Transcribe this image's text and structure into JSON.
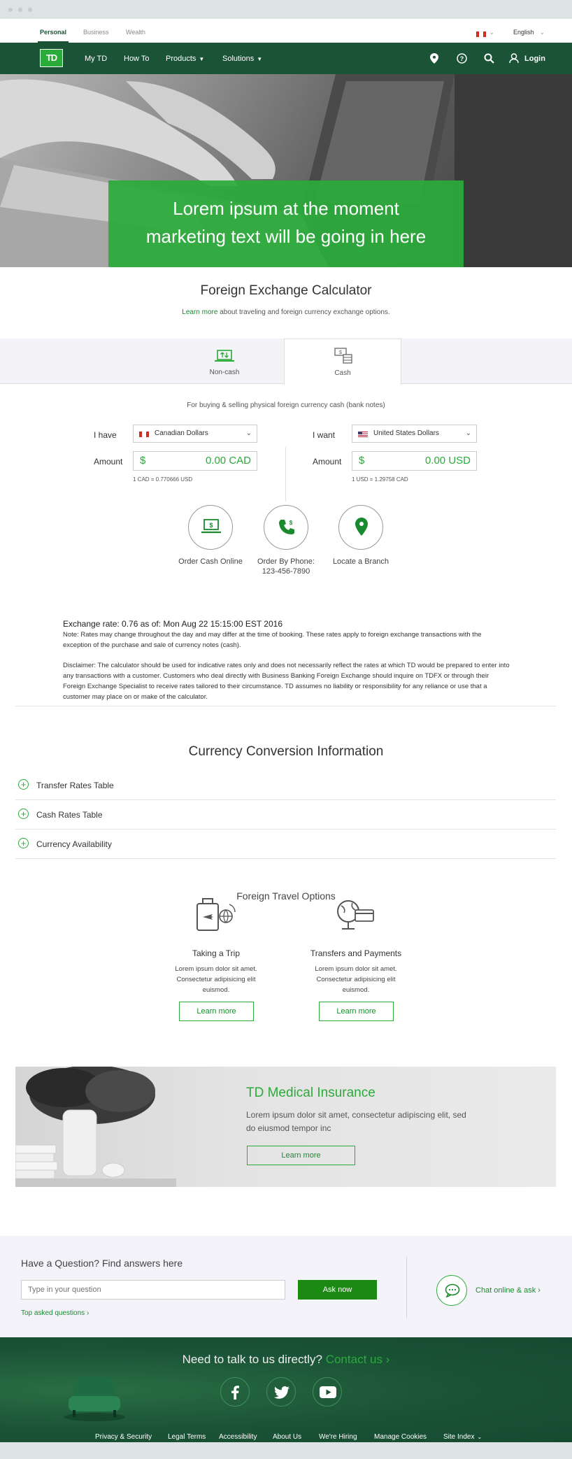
{
  "util": {
    "tabs": [
      "Personal",
      "Business",
      "Wealth"
    ],
    "language": "English"
  },
  "nav": {
    "logo": "TD",
    "items": [
      "My TD",
      "How To",
      "Products",
      "Solutions"
    ],
    "login": "Login"
  },
  "hero": {
    "line1": "Lorem ipsum at the moment",
    "line2": "marketing text will be going in here"
  },
  "calc": {
    "title": "Foreign Exchange Calculator",
    "learn_more": "Learn more",
    "subtitle_rest": " about traveling and foreign currency exchange options.",
    "tabs": [
      "Non-cash",
      "Cash"
    ],
    "desc": "For buying & selling physical foreign currency cash (bank notes)",
    "have_label": "I have",
    "want_label": "I want",
    "amount_label": "Amount",
    "have_currency": "Canadian Dollars",
    "want_currency": "United States Dollars",
    "currency_symbol": "$",
    "have_amount": "0.00 CAD",
    "want_amount": "0.00 USD",
    "have_rate": "1 CAD = 0.770666 USD",
    "want_rate": "1 USD = 1.29758 CAD"
  },
  "actions": {
    "order_online": "Order Cash Online",
    "order_phone": "Order By Phone:",
    "phone": "123-456-7890",
    "locate": "Locate a Branch"
  },
  "exchange": {
    "title": "Exchange rate: 0.76 as of: Mon Aug 22 15:15:00 EST 2016",
    "note": "Note: Rates may change throughout the day and may differ at the time of booking. These rates apply to foreign exchange transactions with the exception of the purchase and sale of currency notes (cash).",
    "disclaimer": "Disclaimer: The calculator should be used for indicative rates only and does not necessarily reflect the rates at which TD would be prepared to enter into any transactions with a customer. Customers who deal directly with Business Banking Foreign Exchange should inquire on TDFX or through their Foreign Exchange Specialist to receive rates tailored to their circumstance. TD assumes no liability or responsibility for any reliance or use that a customer may place on or make of the calculator."
  },
  "conversion": {
    "title": "Currency Conversion Information",
    "items": [
      "Transfer Rates Table",
      "Cash Rates Table",
      "Currency Availability"
    ]
  },
  "travel": {
    "title": "Foreign Travel Options",
    "cards": [
      {
        "title": "Taking a Trip",
        "desc": "Lorem ipsum dolor sit amet. Consectetur adipisicing elit euismod.",
        "button": "Learn more"
      },
      {
        "title": "Transfers and Payments",
        "desc": "Lorem ipsum dolor sit amet. Consectetur adipisicing elit euismod.",
        "button": "Learn more"
      }
    ]
  },
  "medical": {
    "title": "TD Medical Insurance",
    "desc": "Lorem ipsum dolor sit amet, consectetur adipiscing elit, sed do eiusmod tempor inc",
    "button": "Learn more"
  },
  "question": {
    "title": "Have a Question? Find answers here",
    "placeholder": "Type in your question",
    "button": "Ask now",
    "top_link": "Top asked questions ›",
    "chat": "Chat online & ask ›"
  },
  "footer": {
    "title": "Need to talk to us directly?",
    "contact": "Contact us ›",
    "links": [
      "Privacy & Security",
      "Legal Terms",
      "Accessibility",
      "About Us",
      "We're Hiring",
      "Manage Cookies",
      "Site Index"
    ]
  },
  "colors": {
    "brand_dark": "#1a5336",
    "brand_green": "#2bab3a"
  }
}
